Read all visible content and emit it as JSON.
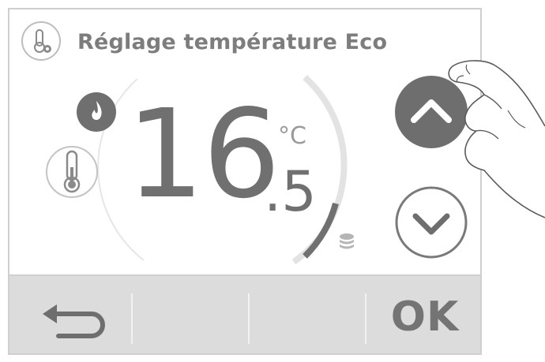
{
  "header": {
    "title": "Réglage température Eco",
    "icon": "thermometer-settings-icon"
  },
  "setpoint": {
    "integer": "16",
    "decimal": ".5",
    "unit": "°C",
    "value": 16.5
  },
  "indicators": {
    "mode_icon": "flame-icon",
    "sensor_icon": "thermometer-icon",
    "eco_icon": "coin-stack-icon"
  },
  "controls": {
    "up_icon": "chevron-up-icon",
    "down_icon": "chevron-down-icon"
  },
  "footer": {
    "back_icon": "back-arrow-icon",
    "ok_label": "OK"
  },
  "colors": {
    "accent_dark": "#6f6f6f",
    "arc_light": "#e5e5e5",
    "footer_bg": "#dcdcdc"
  }
}
